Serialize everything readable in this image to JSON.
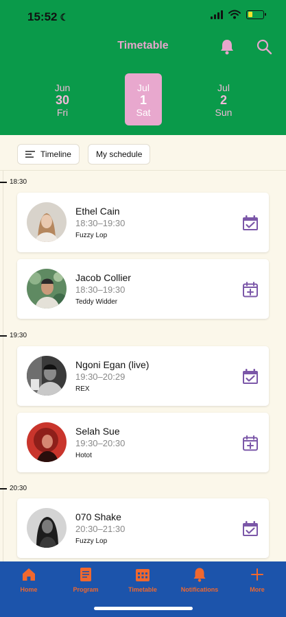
{
  "status": {
    "time": "15:52"
  },
  "header": {
    "title": "Timetable"
  },
  "days": [
    {
      "month": "Jun",
      "day": "30",
      "weekday": "Fri",
      "active": false
    },
    {
      "month": "Jul",
      "day": "1",
      "weekday": "Sat",
      "active": true
    },
    {
      "month": "Jul",
      "day": "2",
      "weekday": "Sun",
      "active": false
    }
  ],
  "toolbar": {
    "timeline_label": "Timeline",
    "my_schedule_label": "My schedule"
  },
  "timeline": {
    "times": [
      "18:30",
      "19:30",
      "20:30"
    ],
    "events": [
      {
        "artist": "Ethel Cain",
        "time": "18:30–19:30",
        "stage": "Fuzzy Lop",
        "in_schedule": true
      },
      {
        "artist": "Jacob Collier",
        "time": "18:30–19:30",
        "stage": "Teddy Widder",
        "in_schedule": false
      },
      {
        "artist": "Ngoni Egan (live)",
        "time": "19:30–20:29",
        "stage": "REX",
        "in_schedule": true
      },
      {
        "artist": "Selah Sue",
        "time": "19:30–20:30",
        "stage": "Hotot",
        "in_schedule": false
      },
      {
        "artist": "070 Shake",
        "time": "20:30–21:30",
        "stage": "Fuzzy Lop",
        "in_schedule": true
      }
    ]
  },
  "nav": {
    "home": "Home",
    "program": "Program",
    "timetable": "Timetable",
    "notifications": "Notifications",
    "more": "More"
  },
  "colors": {
    "header_bg": "#0a9a4a",
    "accent_pink": "#e8a8ce",
    "calendar_purple": "#7b57a8",
    "nav_bg": "#1c54ab",
    "nav_fg": "#f0682e",
    "page_bg": "#fbf7ea"
  }
}
